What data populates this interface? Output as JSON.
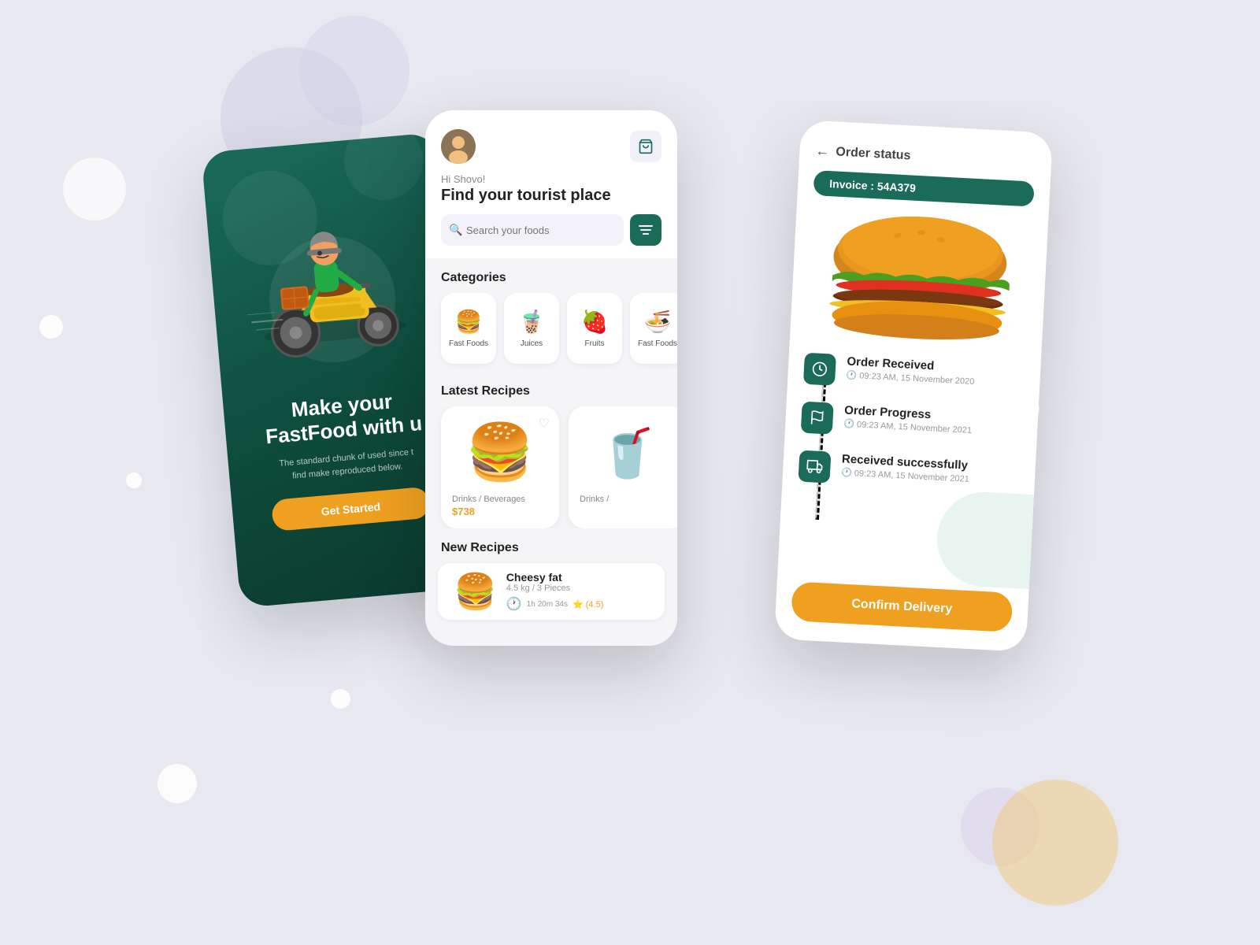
{
  "background": {
    "color": "#e8e8f0"
  },
  "phone_left": {
    "headline": "Make your\nFastFood with u",
    "subtext": "The standard chunk of used since t\nfind make reproduced below.",
    "cta_label": "Get Started",
    "bg_color": "#1a6b5a"
  },
  "phone_middle": {
    "greeting": "Hi Shovo!",
    "main_title": "Find your tourist place",
    "search_placeholder": "Search your foods",
    "cart_icon": "cart-icon",
    "sections": {
      "categories_title": "Categories",
      "categories": [
        {
          "label": "Fast Foods",
          "emoji": "🍔"
        },
        {
          "label": "Juices",
          "emoji": "🧋"
        },
        {
          "label": "Fruits",
          "emoji": "🍓"
        },
        {
          "label": "Fast Foods",
          "emoji": "🍜"
        }
      ],
      "latest_recipes_title": "Latest Recipes",
      "latest_recipes": [
        {
          "label": "Drinks / Beverages",
          "price": "$738",
          "emoji": "🍔"
        },
        {
          "label": "Drinks /",
          "price": "",
          "emoji": "🥤"
        }
      ],
      "new_recipes_title": "New Recipes",
      "new_recipes": [
        {
          "name": "Cheesy fat",
          "size": "4.5 kg / 3 Pieces",
          "time": "1h 20m 34s",
          "rating": "(4.5)",
          "emoji": "🍔"
        }
      ]
    }
  },
  "phone_right": {
    "back_label": "Order status",
    "invoice_label": "Invoice : 54A379",
    "timeline": [
      {
        "event": "Order Received",
        "time": "09:23 AM, 15 November 2020",
        "icon": "clock-icon"
      },
      {
        "event": "Order Progress",
        "time": "09:23 AM, 15 November 2021",
        "icon": "flag-icon"
      },
      {
        "event": "Received successfully",
        "time": "09:23 AM, 15 November 2021",
        "icon": "delivery-icon"
      }
    ],
    "confirm_label": "Confirm Delivery"
  }
}
